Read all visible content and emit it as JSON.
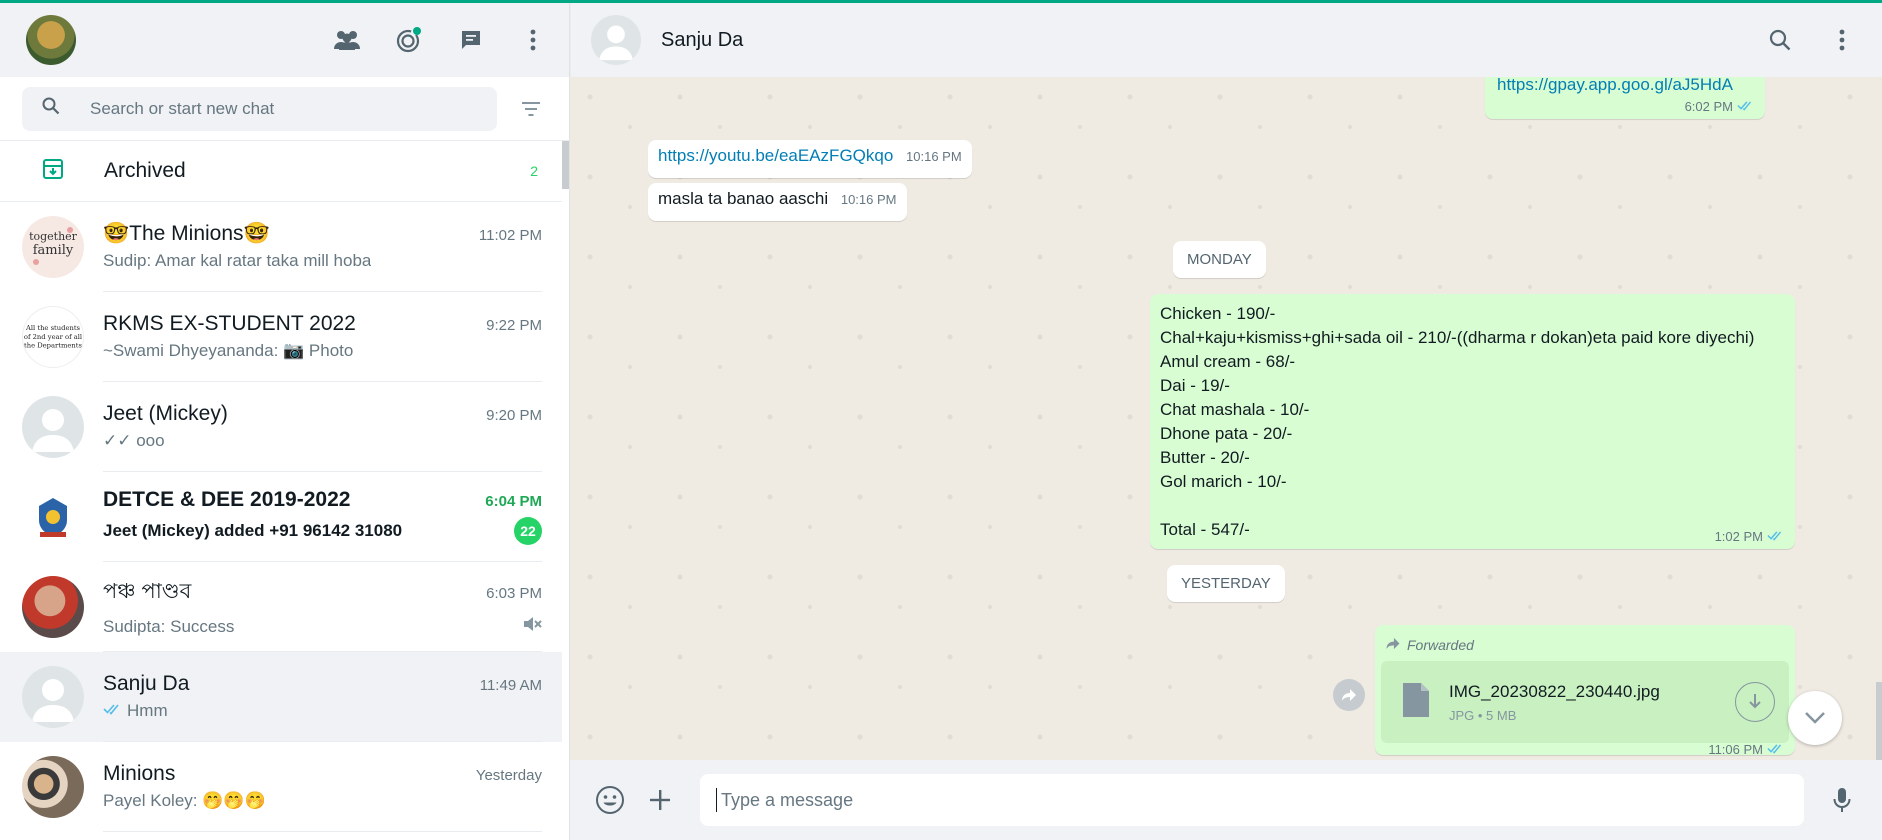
{
  "sidebar": {
    "header_icons": [
      "communities-icon",
      "status-icon",
      "new-chat-icon",
      "menu-icon"
    ],
    "search_placeholder": "Search or start new chat",
    "archived_label": "Archived",
    "archived_count": "2",
    "chats": [
      {
        "name": "🤓The Minions🤓",
        "time": "11:02 PM",
        "preview": "Sudip: Amar kal ratar taka mill hoba"
      },
      {
        "name": "RKMS EX-STUDENT 2022",
        "time": "9:22 PM",
        "preview": "~Swami Dhyeyananda: 📷 Photo"
      },
      {
        "name": "Jeet (Mickey)",
        "time": "9:20 PM",
        "preview": "✓✓ ooo"
      },
      {
        "name": "DETCE & DEE 2019-2022",
        "time": "6:04 PM",
        "preview": "Jeet (Mickey) added +91 96142 31080",
        "unread": "22"
      },
      {
        "name": "পঞ্চ পাণ্ডব",
        "time": "6:03 PM",
        "preview": "Sudipta: Success"
      },
      {
        "name": "Sanju Da",
        "time": "11:49 AM",
        "preview": "Hmm"
      },
      {
        "name": "Minions",
        "time": "Yesterday",
        "preview": "Payel Koley: 🤭🤭🤭"
      }
    ]
  },
  "conversation": {
    "contact_name": "Sanju Da",
    "messages": {
      "gpay_link": "https://gpay.app.goo.gl/aJ5HdA",
      "gpay_time": "6:02 PM",
      "yt_link": "https://youtu.be/eaEAzFGQkqo",
      "yt_time": "10:16 PM",
      "masla_text": "masla ta banao aaschi",
      "masla_time": "10:16 PM",
      "date_monday": "MONDAY",
      "list_lines": [
        "Chicken - 190/-",
        "Chal+kaju+kismiss+ghi+sada oil - 210/-((dharma r dokan)eta paid kore diyechi)",
        "Amul cream - 68/-",
        "Dai - 19/-",
        "Chat mashala - 10/-",
        "Dhone pata - 20/-",
        "Butter - 20/-",
        "Gol marich - 10/-",
        "",
        "Total - 547/-"
      ],
      "list_time": "1:02 PM",
      "date_yesterday": "YESTERDAY",
      "forwarded_label": "Forwarded",
      "file_name": "IMG_20230822_230440.jpg",
      "file_meta": "JPG • 5 MB",
      "file_time": "11:06 PM"
    }
  },
  "composer": {
    "placeholder": "Type a message"
  },
  "colors": {
    "accent": "#00a884",
    "outgoing_bubble": "#d9fdd3",
    "unread_badge": "#25d366"
  }
}
